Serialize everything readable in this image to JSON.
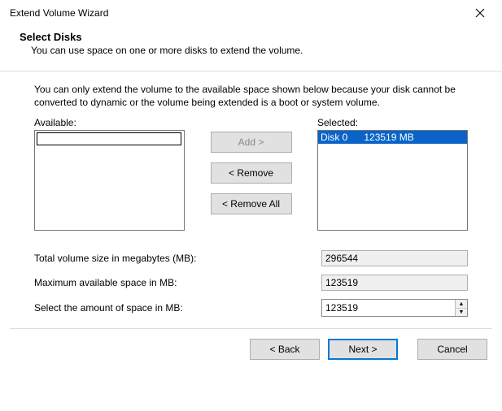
{
  "window": {
    "title": "Extend Volume Wizard"
  },
  "header": {
    "title": "Select Disks",
    "subtitle": "You can use space on one or more disks to extend the volume."
  },
  "info": "You can only extend the volume to the available space shown below because your disk cannot be converted to dynamic or the volume being extended is a boot or system volume.",
  "labels": {
    "available": "Available:",
    "selected": "Selected:"
  },
  "buttons": {
    "add": "Add >",
    "remove": "< Remove",
    "remove_all": "< Remove All",
    "back": "< Back",
    "next": "Next >",
    "cancel": "Cancel"
  },
  "selected_list": {
    "item0": "Disk 0      123519 MB"
  },
  "fields": {
    "total_label": "Total volume size in megabytes (MB):",
    "total_value": "296544",
    "max_label": "Maximum available space in MB:",
    "max_value": "123519",
    "amount_label": "Select the amount of space in MB:",
    "amount_value": "123519"
  }
}
